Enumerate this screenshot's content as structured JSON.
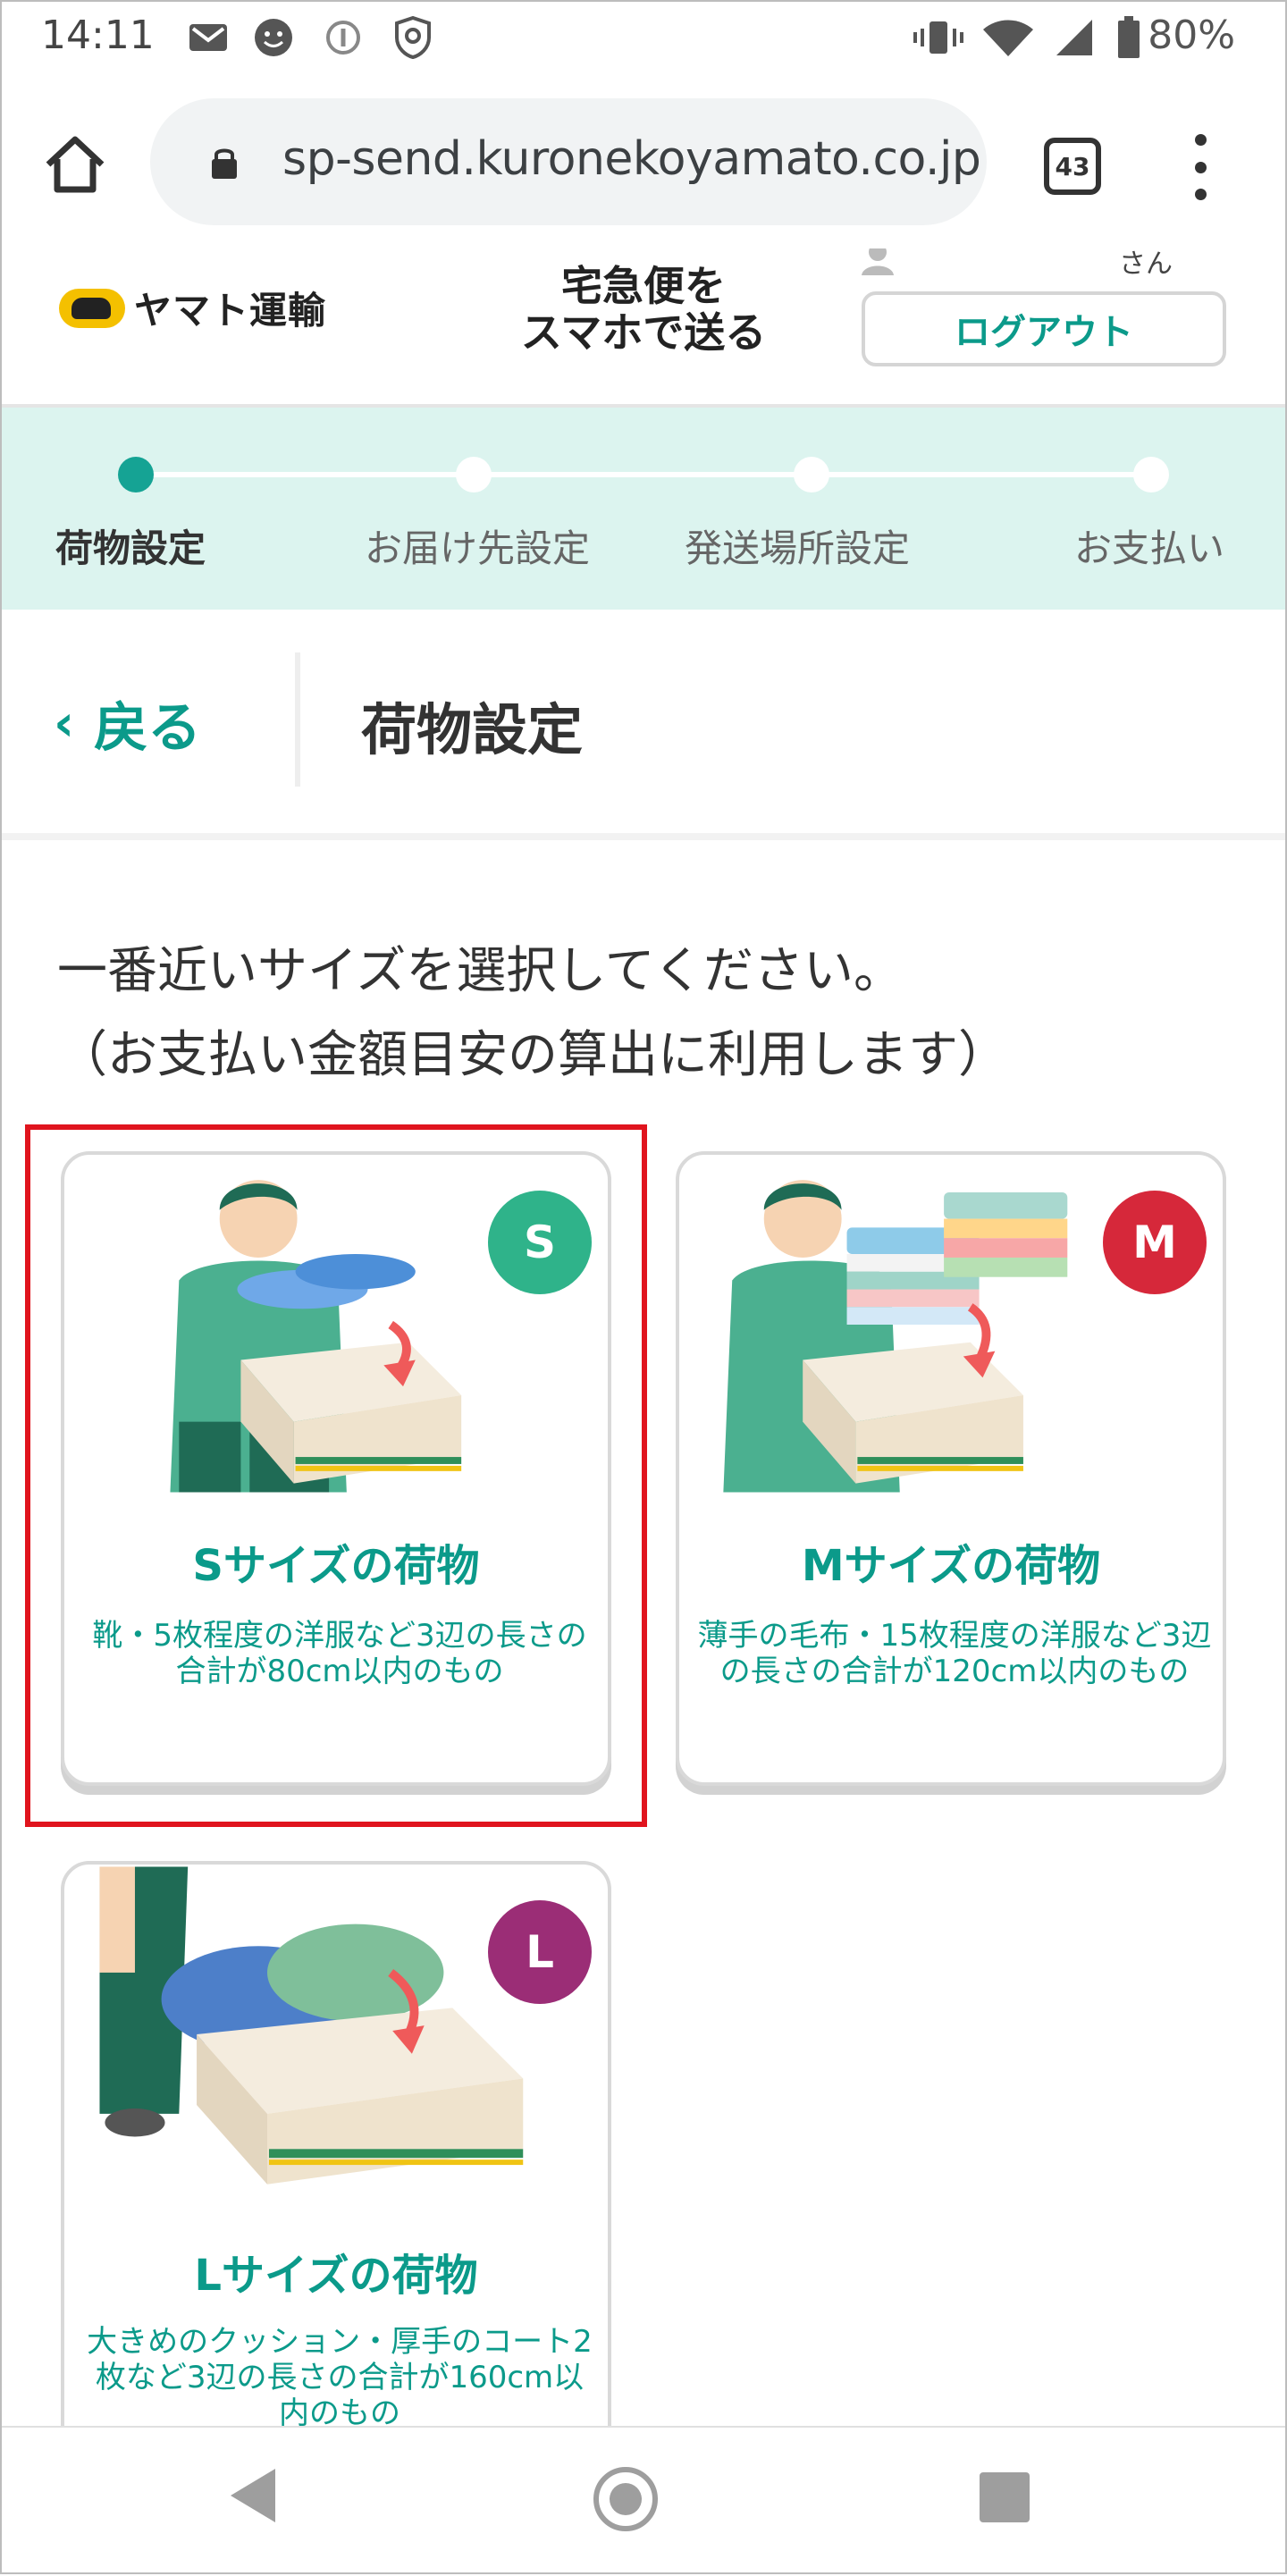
{
  "status_bar": {
    "time": "14:11",
    "battery": "80%",
    "icons": [
      "gmail-icon",
      "face-icon",
      "info-icon",
      "shield-icon",
      "vibrate-icon",
      "wifi-icon",
      "signal-icon",
      "battery-icon"
    ]
  },
  "browser": {
    "url": "sp-send.kuronekoyamato.co.jp",
    "tab_count": "43"
  },
  "header": {
    "brand": "ヤマト運輸",
    "service_title": "宅急便を\nスマホで送る",
    "user_suffix": "さん",
    "logout_label": "ログアウト",
    "accent_color": "#0b9a8a"
  },
  "steps": [
    {
      "label": "荷物設定",
      "active": true
    },
    {
      "label": "お届け先設定",
      "active": false
    },
    {
      "label": "発送場所設定",
      "active": false
    },
    {
      "label": "お支払い",
      "active": false
    }
  ],
  "page": {
    "back_label": "戻る",
    "title": "荷物設定",
    "instruction": "一番近いサイズを選択してください。\n（お支払い金額目安の算出に利用します）"
  },
  "sizes": [
    {
      "badge": "S",
      "badge_color": "#2fb38a",
      "title": "Sサイズの荷物",
      "desc": "靴・5枚程度の洋服など3辺の長さの合計が80cm以内のもの",
      "selected": true
    },
    {
      "badge": "M",
      "badge_color": "#d6283a",
      "title": "Mサイズの荷物",
      "desc": "薄手の毛布・15枚程度の洋服など3辺の長さの合計が120cm以内のもの",
      "selected": false
    },
    {
      "badge": "L",
      "badge_color": "#9b2d76",
      "title": "Lサイズの荷物",
      "desc": "大きめのクッション・厚手のコート2枚など3辺の長さの合計が160cm以内のもの",
      "selected": false
    }
  ],
  "nav": {
    "back": "back-icon",
    "home": "home-icon",
    "recent": "recent-apps-icon"
  }
}
